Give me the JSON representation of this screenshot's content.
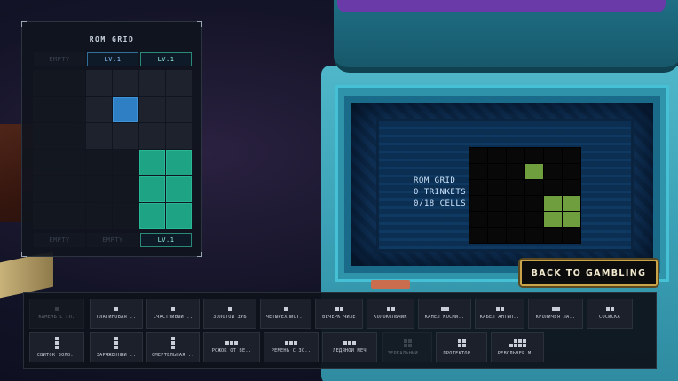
{
  "rom_panel": {
    "title": "ROM GRID",
    "top_slots": [
      "EMPTY",
      "LV.1",
      "LV.1"
    ],
    "bottom_slots": [
      "EMPTY",
      "EMPTY",
      "LV.1"
    ]
  },
  "bin": {
    "line1": "ROM GRID",
    "line2": "0 TRINKETS",
    "line3": "0/18 CELLS"
  },
  "back_button": "BACK TO GAMBLING",
  "inventory": [
    {
      "label": "КАМЕНЬ С ГЛ.",
      "icon": "dot",
      "disabled": true
    },
    {
      "label": "ПЛАТИНОВАЯ ..",
      "icon": "dot",
      "disabled": false
    },
    {
      "label": "СЧАСТЛИВЫЙ ..",
      "icon": "dot",
      "disabled": false
    },
    {
      "label": "ЗОЛОТОЙ ЗУБ",
      "icon": "dot",
      "disabled": false
    },
    {
      "label": "ЧЕТЫРЕХЛИСТ..",
      "icon": "dot",
      "disabled": false
    },
    {
      "label": "ВЕЧЕРК ЧИЗЕ",
      "icon": "pair",
      "disabled": false
    },
    {
      "label": "КОЛОКОЛЬЧИК",
      "icon": "pair",
      "disabled": false
    },
    {
      "label": "КАНЕЛ КОСМИ..",
      "icon": "pair",
      "disabled": false
    },
    {
      "label": "КАБЕЛ АНТИП..",
      "icon": "pair",
      "disabled": false
    },
    {
      "label": "КРОЛИЧЬЯ ЛА..",
      "icon": "pair",
      "disabled": false
    },
    {
      "label": "СОСИСКА",
      "icon": "pair",
      "disabled": false
    },
    {
      "label": "СВИТОК ЗОЛО..",
      "icon": "tall",
      "disabled": false
    },
    {
      "label": "ЗАРЯЖЕННЫЙ ..",
      "icon": "tall",
      "disabled": false
    },
    {
      "label": "СМЕРТЕЛЬНАЯ ..",
      "icon": "tall",
      "disabled": false
    },
    {
      "label": "РОЖОК ОТ ВЕ..",
      "icon": "wide",
      "disabled": false
    },
    {
      "label": "РЕМЕНЬ С ЗО..",
      "icon": "wide",
      "disabled": false
    },
    {
      "label": "ЛЕДЯНОЙ МЕЧ",
      "icon": "wide",
      "disabled": false
    },
    {
      "label": "ЗЕРКАЛЬНЫЙ ..",
      "icon": "block",
      "disabled": true
    },
    {
      "label": "ПРОТЕКТОР ..",
      "icon": "block",
      "disabled": false
    },
    {
      "label": "РЕВОЛЬВЕР М..",
      "icon": "ell",
      "disabled": false
    }
  ],
  "colors": {
    "accent_gold": "#c9a44a",
    "rom_teal": "#1ea484",
    "rom_blue": "#2f7fc4",
    "bin_green": "#6f9e3e"
  }
}
